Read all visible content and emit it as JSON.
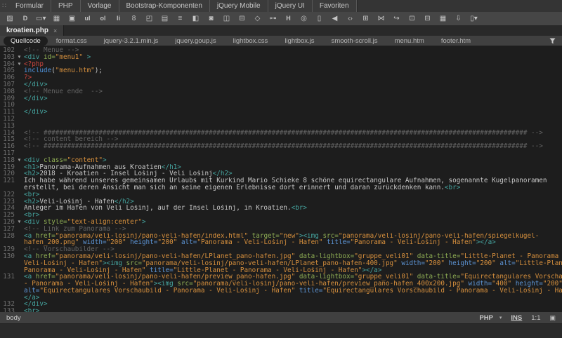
{
  "insert_bar": {
    "grip_glyph": "∷",
    "categories": [
      "Formular",
      "PHP",
      "Vorlage",
      "Bootstrap-Komponenten",
      "jQuery Mobile",
      "jQuery UI",
      "Favoriten"
    ]
  },
  "toolbar": {
    "icons": [
      {
        "name": "image-icon",
        "glyph": "▨"
      },
      {
        "name": "description-list-icon",
        "glyph": "D"
      },
      {
        "name": "pill-button-menu-icon",
        "glyph": "▭▾"
      },
      {
        "name": "table-icon",
        "glyph": "▦"
      },
      {
        "name": "figure-image-icon",
        "glyph": "▣"
      },
      {
        "name": "unordered-list-icon",
        "glyph": "ul"
      },
      {
        "name": "ordered-list-icon",
        "glyph": "ol"
      },
      {
        "name": "list-item-icon",
        "glyph": "li"
      },
      {
        "name": "anchor-link-icon",
        "glyph": "8"
      },
      {
        "name": "header-element-icon",
        "glyph": "◰"
      },
      {
        "name": "media-embed-icon",
        "glyph": "▤"
      },
      {
        "name": "nav-list-icon",
        "glyph": "≡"
      },
      {
        "name": "split-panel-icon",
        "glyph": "◧"
      },
      {
        "name": "iframe-icon",
        "glyph": "◙"
      },
      {
        "name": "aside-panel-icon",
        "glyph": "◫"
      },
      {
        "name": "footer-panel-icon",
        "glyph": "⊟"
      },
      {
        "name": "tag-icon",
        "glyph": "◇"
      },
      {
        "name": "key-icon",
        "glyph": "⊶"
      },
      {
        "name": "heading-icon",
        "glyph": "H"
      },
      {
        "name": "target-circle-icon",
        "glyph": "◎"
      },
      {
        "name": "page-icon",
        "glyph": "▯"
      },
      {
        "name": "audio-icon",
        "glyph": "◀"
      },
      {
        "name": "code-page-icon",
        "glyph": "‹›"
      },
      {
        "name": "copy-pages-icon",
        "glyph": "⊞"
      },
      {
        "name": "asterisk-snap-icon",
        "glyph": "⋈"
      },
      {
        "name": "redo-arrow-icon",
        "glyph": "↪"
      },
      {
        "name": "embed-box-icon",
        "glyph": "⊡"
      },
      {
        "name": "printer-icon",
        "glyph": "⊟"
      },
      {
        "name": "calendar-icon",
        "glyph": "▦"
      },
      {
        "name": "download-icon",
        "glyph": "⇩"
      },
      {
        "name": "paste-menu-icon",
        "glyph": "▯▾"
      }
    ]
  },
  "document_tab": {
    "title": "kroatien.php",
    "close_glyph": "×"
  },
  "related_files": {
    "selected_index": 0,
    "items": [
      "Quellcode",
      "format.css",
      "jquery-3.2.1.min.js",
      "jquery.goup.js",
      "lightbox.css",
      "lightbox.js",
      "smooth-scroll.js",
      "menu.htm",
      "footer.htm"
    ],
    "filter_icon": "funnel-icon"
  },
  "editor": {
    "rows": [
      {
        "n": "102",
        "t": [
          [
            "c",
            "<!-- Menue -->"
          ]
        ]
      },
      {
        "n": "103",
        "fold": true,
        "t": [
          [
            "t",
            "<div "
          ],
          [
            "g",
            "id="
          ],
          [
            "v",
            "\"menu1\""
          ],
          [
            "t",
            " >"
          ]
        ]
      },
      {
        "n": "104",
        "fold": true,
        "t": [
          [
            "r",
            "<?php"
          ]
        ]
      },
      {
        "n": "105",
        "t": [
          [
            "f",
            "include"
          ],
          [
            "p",
            "("
          ],
          [
            "v",
            "\"menu.htm\""
          ],
          [
            "p",
            ");"
          ]
        ]
      },
      {
        "n": "106",
        "t": [
          [
            "r",
            "?>"
          ]
        ]
      },
      {
        "n": "107",
        "t": [
          [
            "t",
            "</div>"
          ]
        ]
      },
      {
        "n": "108",
        "t": [
          [
            "c",
            "<!-- Menue ende  -->"
          ]
        ]
      },
      {
        "n": "109",
        "t": [
          [
            "t",
            "</div>"
          ]
        ]
      },
      {
        "n": "110",
        "t": []
      },
      {
        "n": "111",
        "t": [
          [
            "t",
            "</div>"
          ]
        ]
      },
      {
        "n": "112",
        "t": []
      },
      {
        "n": "113",
        "t": []
      },
      {
        "n": "114",
        "t": [
          [
            "c",
            "<!-- ########################################################################################################################### -->"
          ]
        ]
      },
      {
        "n": "115",
        "t": [
          [
            "c",
            "<!-- content bereich -->"
          ]
        ]
      },
      {
        "n": "116",
        "t": [
          [
            "c",
            "<!-- ########################################################################################################################### -->"
          ]
        ]
      },
      {
        "n": "117",
        "t": []
      },
      {
        "n": "118",
        "fold": true,
        "t": [
          [
            "t",
            "<div "
          ],
          [
            "g",
            "class="
          ],
          [
            "v",
            "\"content\""
          ],
          [
            "t",
            ">"
          ]
        ]
      },
      {
        "n": "119",
        "t": [
          [
            "t",
            "<h1>"
          ],
          [
            "p",
            "Panorama-Aufnahmen aus Kroatien"
          ],
          [
            "t",
            "</h1>"
          ]
        ]
      },
      {
        "n": "120",
        "t": [
          [
            "t",
            "<h2>"
          ],
          [
            "p",
            "2018 - Kroatien - Insel Lošinj - Veli Lošinj"
          ],
          [
            "t",
            "</h2>"
          ]
        ]
      },
      {
        "n": "121",
        "t": [
          [
            "p",
            "Ich habe während unseres gemeinsamen Urlaubs mit Kurkind Mario Schieke 8 schöne equirectangulare Aufnahmen, sogenannte Kugelpanoramen"
          ]
        ]
      },
      {
        "n": "",
        "t": [
          [
            "p",
            "erstellt, bei deren Ansicht man sich an seine eigenen Erlebnisse dort erinnert und daran zurückdenken kann."
          ],
          [
            "t",
            "<br>"
          ]
        ]
      },
      {
        "n": "122",
        "t": [
          [
            "t",
            "<br>"
          ]
        ]
      },
      {
        "n": "123",
        "t": [
          [
            "t",
            "<h2>"
          ],
          [
            "p",
            "Veli-Lošinj - Hafen"
          ],
          [
            "t",
            "</h2>"
          ]
        ]
      },
      {
        "n": "124",
        "t": [
          [
            "p",
            "Anleger im Hafen von Veli Lošinj, auf der Insel Lošinj, in Kroatien."
          ],
          [
            "t",
            "<br>"
          ]
        ]
      },
      {
        "n": "125",
        "t": [
          [
            "t",
            "<br>"
          ]
        ]
      },
      {
        "n": "126",
        "fold": true,
        "t": [
          [
            "t",
            "<div "
          ],
          [
            "g",
            "style="
          ],
          [
            "v",
            "\"text-align:center\""
          ],
          [
            "t",
            ">"
          ]
        ]
      },
      {
        "n": "127",
        "t": [
          [
            "c",
            "<!-- Link zum Panorama -->"
          ]
        ]
      },
      {
        "n": "128",
        "t": [
          [
            "t",
            "<a "
          ],
          [
            "g",
            "href="
          ],
          [
            "v",
            "\"panorama/veli-losinj/pano-veli-hafen/index.html\""
          ],
          [
            "g",
            " target="
          ],
          [
            "v",
            "\"new\""
          ],
          [
            "t",
            "><img "
          ],
          [
            "g",
            "src="
          ],
          [
            "v",
            "\"panorama/veli-losinj/pano-veli-hafen/spiegelkugel-"
          ]
        ]
      },
      {
        "n": "",
        "t": [
          [
            "v",
            "hafen_200.png\""
          ],
          [
            "b",
            " width="
          ],
          [
            "v",
            "\"200\""
          ],
          [
            "b",
            " height="
          ],
          [
            "v",
            "\"200\""
          ],
          [
            "b",
            " alt="
          ],
          [
            "v",
            "\"Panorama - Veli-Lošinj - Hafen\""
          ],
          [
            "b",
            " title="
          ],
          [
            "v",
            "\"Panorama - Veli-Lošinj - Hafen\""
          ],
          [
            "t",
            "></a>"
          ]
        ]
      },
      {
        "n": "129",
        "t": [
          [
            "c",
            "<!-- Vorschaubilder -->"
          ]
        ]
      },
      {
        "n": "130",
        "t": [
          [
            "t",
            "<a "
          ],
          [
            "g",
            "href="
          ],
          [
            "v",
            "\"panorama/veli-losinj/pano-veli-hafen/LPlanet_pano-hafen.jpg\""
          ],
          [
            "g",
            " data-lightbox="
          ],
          [
            "v",
            "\"gruppe_veli01\""
          ],
          [
            "g",
            " data-title="
          ],
          [
            "v",
            "\"Little-Planet - Panorama -"
          ]
        ]
      },
      {
        "n": "",
        "t": [
          [
            "v",
            "Veli-Lošinj - Hafen\""
          ],
          [
            "t",
            "><img "
          ],
          [
            "g",
            "src="
          ],
          [
            "v",
            "\"panorama/veli-losinj/pano-veli-hafen/LPlanet_pano-hafen-400.jpg\""
          ],
          [
            "b",
            " width="
          ],
          [
            "v",
            "\"200\""
          ],
          [
            "b",
            " height="
          ],
          [
            "v",
            "\"200\""
          ],
          [
            "b",
            " alt="
          ],
          [
            "v",
            "\"Little-Planet -"
          ]
        ]
      },
      {
        "n": "",
        "t": [
          [
            "v",
            "Panorama - Veli-Lošinj - Hafen\""
          ],
          [
            "b",
            " title="
          ],
          [
            "v",
            "\"Little-Planet - Panorama - Veli-Lošinj - Hafen\""
          ],
          [
            "t",
            "></a>"
          ]
        ]
      },
      {
        "n": "131",
        "t": [
          [
            "t",
            "<a "
          ],
          [
            "g",
            "href="
          ],
          [
            "v",
            "\"panorama/veli-losinj/pano-veli-hafen/preview_pano-hafen.jpg\""
          ],
          [
            "g",
            " data-lightbox="
          ],
          [
            "v",
            "\"gruppe_veli01\""
          ],
          [
            "g",
            " data-title="
          ],
          [
            "v",
            "\"Equirectangulares Vorschaubild"
          ]
        ]
      },
      {
        "n": "",
        "t": [
          [
            "v",
            "- Panorama - Veli-Lošinj - Hafen\""
          ],
          [
            "t",
            "><img "
          ],
          [
            "g",
            "src="
          ],
          [
            "v",
            "\"panorama/veli-losinj/pano-veli-hafen/preview_pano-hafen_400x200.jpg\""
          ],
          [
            "b",
            " width="
          ],
          [
            "v",
            "\"400\""
          ],
          [
            "b",
            " height="
          ],
          [
            "v",
            "\"200\""
          ]
        ]
      },
      {
        "n": "",
        "t": [
          [
            "b",
            "alt="
          ],
          [
            "v",
            "\"Equirectangulares Vorschaubild - Panorama - Veli-Lošinj - Hafen\""
          ],
          [
            "b",
            " title="
          ],
          [
            "v",
            "\"Equirectangulares Vorschaubild - Panorama - Veli-Lošinj - Hafen\""
          ],
          [
            "t",
            ">"
          ]
        ]
      },
      {
        "n": "",
        "t": [
          [
            "t",
            "</a>"
          ]
        ]
      },
      {
        "n": "132",
        "t": [
          [
            "t",
            "</div>"
          ]
        ]
      },
      {
        "n": "133",
        "t": [
          [
            "t",
            "<br>"
          ]
        ]
      }
    ]
  },
  "status_bar": {
    "tag": "body",
    "language": "PHP",
    "dropdown_glyph": "▾",
    "insert_mode": "INS",
    "position": "1:1",
    "panel_icon_glyph": "▣"
  },
  "colors": {
    "bg-code": "#1d1d1d",
    "bar-cats": "#3b3b3b",
    "bar-icons": "#464646",
    "bar-doctab": "#292929",
    "tab-bg": "#3a3a3a",
    "bar-related": "#404040",
    "pill-bg": "#1e1e1e",
    "status-bg": "#404040",
    "bottom-bg": "#2a2a2a",
    "text-ui": "#c6c6c6",
    "syntax-comment": "#646464",
    "syntax-tag": "#45a49f",
    "syntax-attr-green": "#8fae54",
    "syntax-attr-blue": "#5d95d6",
    "syntax-value": "#d7903d",
    "syntax-php": "#c8453e",
    "syntax-func": "#4f93dc",
    "syntax-plain": "#c8c8c8",
    "syntax-lineno": "#6e6e6e"
  }
}
